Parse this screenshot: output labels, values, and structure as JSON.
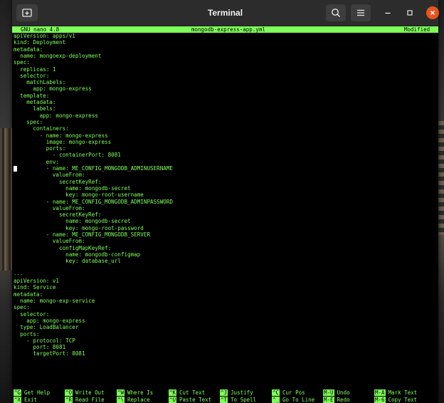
{
  "window": {
    "title": "Terminal"
  },
  "header": {
    "version": "GNU nano 4.8",
    "filename": "mongodb-express-app.yml",
    "status": "Modified"
  },
  "lines": [
    "apiVersion: apps/v1",
    "kind: Deployment",
    "metadata:",
    "  name: mongoexp-deployment",
    "spec:",
    "  replicas: 1",
    "  selector:",
    "    matchLabels:",
    "      app: mongo-express",
    "  template:",
    "    metadata:",
    "      labels:",
    "        app: mongo-express",
    "    spec:",
    "      containers:",
    "        - name: mongo-express",
    "          image: mongo-express",
    "          ports:",
    "            - containerPort: 8081",
    "          env:",
    "          - name: ME_CONFIG_MONGODB_ADMINUSERNAME",
    "            valueFrom:",
    "              secretKeyRef:",
    "                name: mongodb-secret",
    "                key: mongo-root-username",
    "          - name: ME_CONFIG_MONGODB_ADMINPASSWORD",
    "            valueFrom:",
    "              secretKeyRef:",
    "                name: mongodb-secret",
    "                key: mongo-root-password",
    "          - name: ME_CONFIG_MONGODB_SERVER",
    "            valueFrom:",
    "              configMapKeyRef:",
    "                name: mongodb-configmap",
    "                key: database_url",
    "",
    "---",
    "apiVersion: v1",
    "kind: Service",
    "metadata:",
    "  name: mongo-exp-service",
    "spec:",
    "  selector:",
    "    app: mongo-express",
    "  type: LoadBalancer",
    "  ports:",
    "    - protocol: TCP",
    "      port: 8081",
    "      targetPort: 8081"
  ],
  "shortcuts": [
    {
      "key": "^G",
      "label": "Get Help"
    },
    {
      "key": "^O",
      "label": "Write Out"
    },
    {
      "key": "^W",
      "label": "Where Is"
    },
    {
      "key": "^K",
      "label": "Cut Text"
    },
    {
      "key": "^J",
      "label": "Justify"
    },
    {
      "key": "^C",
      "label": "Cur Pos"
    },
    {
      "key": "M-U",
      "label": "Undo"
    },
    {
      "key": "M-A",
      "label": "Mark Text"
    },
    {
      "key": "^X",
      "label": "Exit"
    },
    {
      "key": "^R",
      "label": "Read File"
    },
    {
      "key": "^\\",
      "label": "Replace"
    },
    {
      "key": "^U",
      "label": "Paste Text"
    },
    {
      "key": "^T",
      "label": "To Spell"
    },
    {
      "key": "^_",
      "label": "Go To Line"
    },
    {
      "key": "M-E",
      "label": "Redo"
    },
    {
      "key": "M-6",
      "label": "Copy Text"
    }
  ],
  "icons": {
    "new_tab": "new-tab-icon",
    "search": "search-icon",
    "menu": "hamburger-menu-icon",
    "minimize": "minimize-icon",
    "maximize": "maximize-icon",
    "close": "close-icon"
  },
  "colors": {
    "terminal_text": "#7fff5a",
    "terminal_bg": "#000000",
    "titlebar": "#2c2c2c",
    "close_button": "#e95420"
  }
}
